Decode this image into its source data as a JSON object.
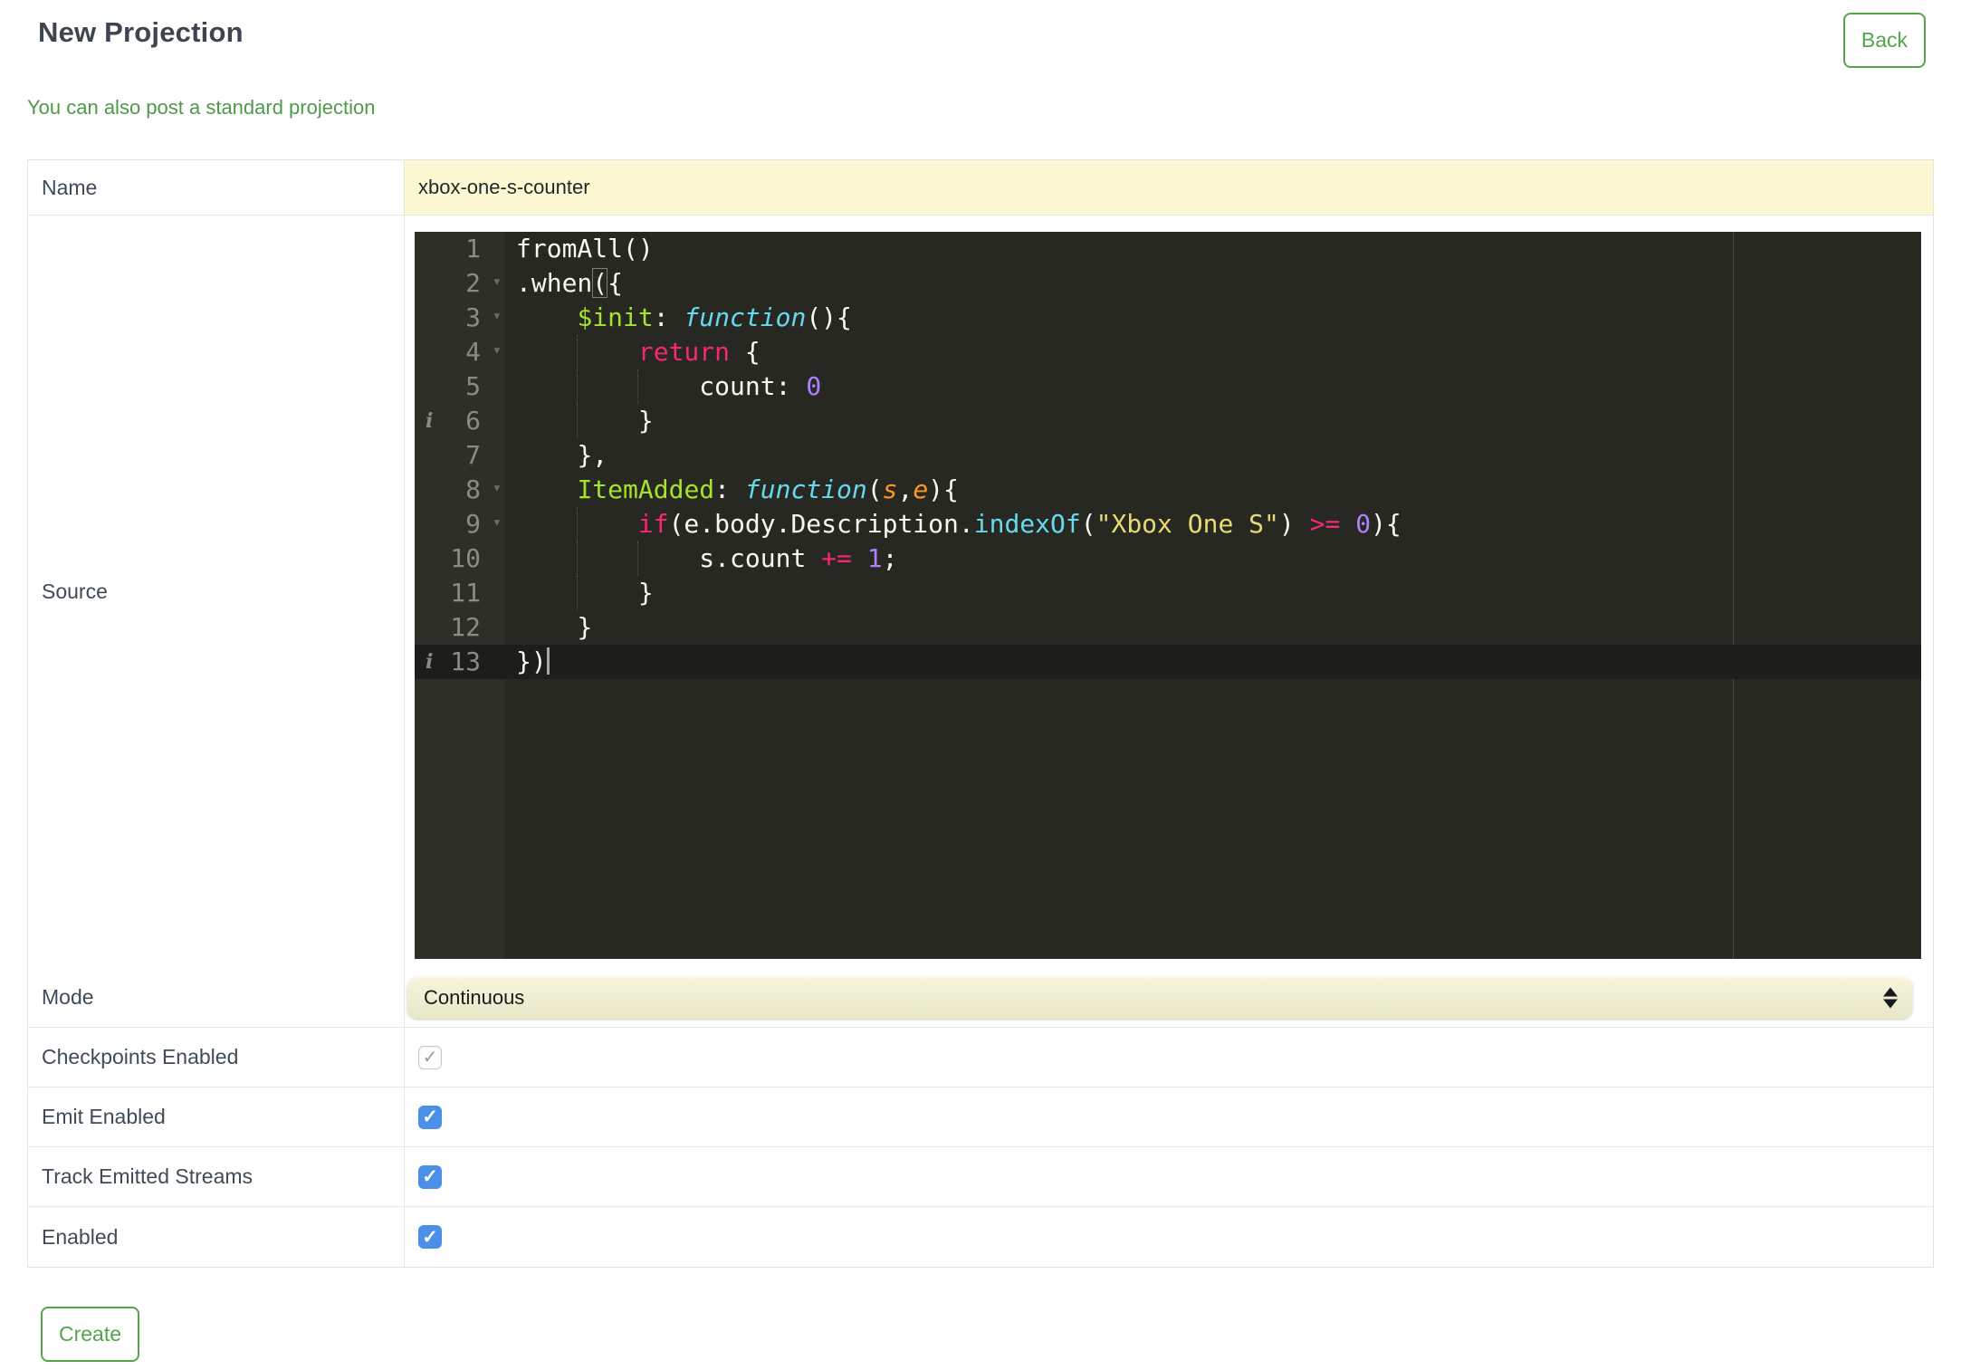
{
  "page": {
    "title": "New Projection",
    "back_label": "Back",
    "link_text": "You can also post a standard projection",
    "create_label": "Create"
  },
  "form": {
    "name": {
      "label": "Name",
      "value": "xbox-one-s-counter"
    },
    "source": {
      "label": "Source"
    },
    "mode": {
      "label": "Mode",
      "value": "Continuous"
    },
    "checkboxes": [
      {
        "label": "Checkpoints Enabled",
        "checked": true,
        "disabled": true
      },
      {
        "label": "Emit Enabled",
        "checked": true,
        "disabled": false
      },
      {
        "label": "Track Emitted Streams",
        "checked": true,
        "disabled": false
      },
      {
        "label": "Enabled",
        "checked": true,
        "disabled": false
      }
    ]
  },
  "editor": {
    "active_line": 13,
    "print_margin_column": 80,
    "lines": [
      {
        "n": 1,
        "indent": 0,
        "tokens": [
          [
            "fromAll()",
            "plain"
          ]
        ]
      },
      {
        "n": 2,
        "indent": 0,
        "fold": true,
        "tokens": [
          [
            ".when",
            "plain"
          ],
          [
            "(",
            "bracket"
          ],
          [
            "{",
            "plain"
          ]
        ]
      },
      {
        "n": 3,
        "indent": 4,
        "fold": true,
        "tokens": [
          [
            "$init",
            "name"
          ],
          [
            ":",
            "plain"
          ],
          [
            " ",
            "plain"
          ],
          [
            "function",
            "fn"
          ],
          [
            "(){",
            "plain"
          ]
        ]
      },
      {
        "n": 4,
        "indent": 8,
        "fold": true,
        "tokens": [
          [
            "return",
            "keyword"
          ],
          [
            " {",
            "plain"
          ]
        ]
      },
      {
        "n": 5,
        "indent": 12,
        "tokens": [
          [
            "count: ",
            "plain"
          ],
          [
            "0",
            "num"
          ]
        ]
      },
      {
        "n": 6,
        "indent": 8,
        "info": true,
        "tokens": [
          [
            "}",
            "plain"
          ]
        ]
      },
      {
        "n": 7,
        "indent": 4,
        "tokens": [
          [
            "},",
            "plain"
          ]
        ]
      },
      {
        "n": 8,
        "indent": 4,
        "fold": true,
        "tokens": [
          [
            "ItemAdded",
            "name"
          ],
          [
            ":",
            "plain"
          ],
          [
            " ",
            "plain"
          ],
          [
            "function",
            "fn"
          ],
          [
            "(",
            "plain"
          ],
          [
            "s",
            "param"
          ],
          [
            ",",
            "plain"
          ],
          [
            "e",
            "param"
          ],
          [
            "){",
            "plain"
          ]
        ]
      },
      {
        "n": 9,
        "indent": 8,
        "fold": true,
        "tokens": [
          [
            "if",
            "keyword"
          ],
          [
            "(e.body.Description.",
            "plain"
          ],
          [
            "indexOf",
            "support"
          ],
          [
            "(",
            "plain"
          ],
          [
            "\"Xbox One S\"",
            "string"
          ],
          [
            ")",
            "plain"
          ],
          [
            " ",
            "plain"
          ],
          [
            ">=",
            "keyword"
          ],
          [
            " ",
            "plain"
          ],
          [
            "0",
            "num"
          ],
          [
            "){",
            "plain"
          ]
        ]
      },
      {
        "n": 10,
        "indent": 12,
        "tokens": [
          [
            "s.count ",
            "plain"
          ],
          [
            "+=",
            "keyword"
          ],
          [
            " ",
            "plain"
          ],
          [
            "1",
            "num"
          ],
          [
            ";",
            "plain"
          ]
        ]
      },
      {
        "n": 11,
        "indent": 8,
        "tokens": [
          [
            "}",
            "plain"
          ]
        ]
      },
      {
        "n": 12,
        "indent": 4,
        "tokens": [
          [
            "}",
            "plain"
          ]
        ]
      },
      {
        "n": 13,
        "indent": 0,
        "info": true,
        "cursor": true,
        "tokens": [
          [
            "})",
            "plain"
          ]
        ]
      }
    ]
  },
  "colors": {
    "accent_green": "#55a44c",
    "link_green": "#4f9a47",
    "label_slate": "#3f4b58",
    "input_yellow": "#fbf8d2",
    "checkbox_blue": "#4a8fe8",
    "editor_bg": "#272822",
    "gutter_bg": "#2e2f28",
    "gutter_text": "#8a8b84",
    "active_line_bg": "#1d1e19",
    "syntax_keyword": "#f92672",
    "syntax_string": "#e6db74",
    "syntax_number": "#ae81ff",
    "syntax_storage": "#66d9ef",
    "syntax_entity": "#a6e22e",
    "syntax_param": "#fd971f"
  }
}
